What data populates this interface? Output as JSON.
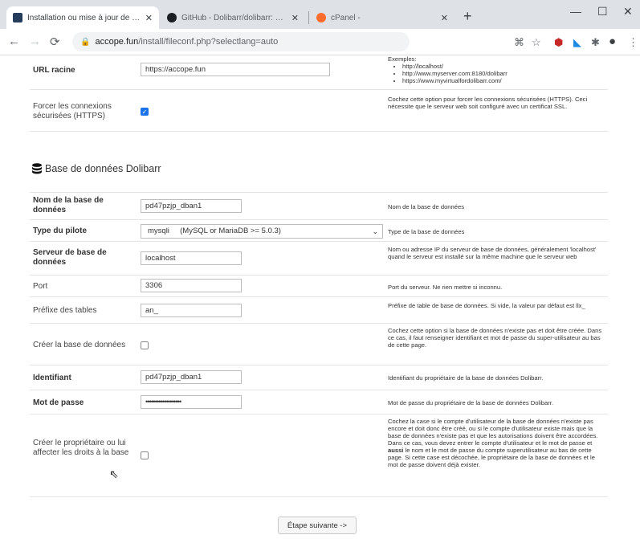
{
  "browser": {
    "tabs": [
      {
        "title": "Installation ou mise à jour de Do",
        "close": "✕",
        "favicon_color": "#263c5c",
        "active": true
      },
      {
        "title": "GitHub - Dolibarr/dolibarr: Doli",
        "close": "✕",
        "favicon_color": "#1b1f23",
        "active": false
      },
      {
        "title": "cPanel -",
        "close": "✕",
        "favicon_color": "#ff6c2c",
        "active": false
      }
    ],
    "new_tab": "+",
    "window_controls": {
      "minimize": "—",
      "maximize": "☐",
      "close": "✕"
    },
    "address": {
      "host": "accope.fun",
      "path": "/install/fileconf.php?selectlang=auto"
    }
  },
  "top_row": {
    "label": "URL racine",
    "value": "https://accope.fun",
    "help_title": "Exemples:",
    "help_examples": [
      "http://localhost/",
      "http://www.myserver.com:8180/dolibarr",
      "https://www.myvirtualfordolibarr.com/"
    ]
  },
  "https_row": {
    "label_line1": "Forcer les connexions",
    "label_line2": "sécurisées (HTTPS)",
    "checked": true,
    "help": "Cochez cette option pour forcer les connexions sécurisées (HTTPS). Ceci nécessite que le serveur web soit configuré avec un certificat SSL."
  },
  "section_title": "Base de données Dolibarr",
  "db_name": {
    "label": "Nom de la base de données",
    "value": "pd47pzjp_dban1",
    "help": "Nom de la base de données"
  },
  "driver": {
    "label": "Type du pilote",
    "value": "mysqli     (MySQL or MariaDB >= 5.0.3)",
    "help": "Type de la base de données"
  },
  "server": {
    "label": "Serveur de base de données",
    "value": "localhost",
    "help": "Nom ou adresse IP du serveur de base de données, généralement 'localhost' quand le serveur est installé sur la même machine que le serveur web"
  },
  "port": {
    "label": "Port",
    "value": "3306",
    "help": "Port du serveur. Ne rien mettre si inconnu."
  },
  "prefix": {
    "label": "Préfixe des tables",
    "value": "an_",
    "help": "Préfixe de table de base de données. Si vide, la valeur par défaut est llx_"
  },
  "create_db": {
    "label": "Créer la base de données",
    "checked": false,
    "help": "Cochez cette option si la base de données n'existe pas et doit être créée. Dans ce cas, il faut renseigner identifiant et mot de passe du super-utilisateur au bas de cette page."
  },
  "login": {
    "label": "Identifiant",
    "value": "pd47pzjp_dban1",
    "help": "Identifiant du propriétaire de la base de données Dolibarr."
  },
  "password": {
    "label": "Mot de passe",
    "value": "•••••••••••••••••••",
    "help": "Mot de passe du propriétaire de la base de données Dolibarr."
  },
  "create_owner": {
    "label": "Créer le propriétaire ou lui affecter les droits à la base",
    "checked": false,
    "help_part1": "Cochez la case si le compte d'utilisateur de la base de données n'existe pas encore et doit donc être créé, ou si le compte d'utilisateur existe mais que la base de données n'existe pas et que les autorisations doivent être accordées. Dans ce cas, vous devez entrer le compte d'utilisateur et le mot de passe et ",
    "help_bold": "aussi",
    "help_part2": " le nom et le mot de passe du compte superutilisateur au bas de cette page. Si cette case est décochée, le propriétaire de la base de données et le mot de passe doivent déjà exister."
  },
  "next_button": "Étape suivante ->"
}
